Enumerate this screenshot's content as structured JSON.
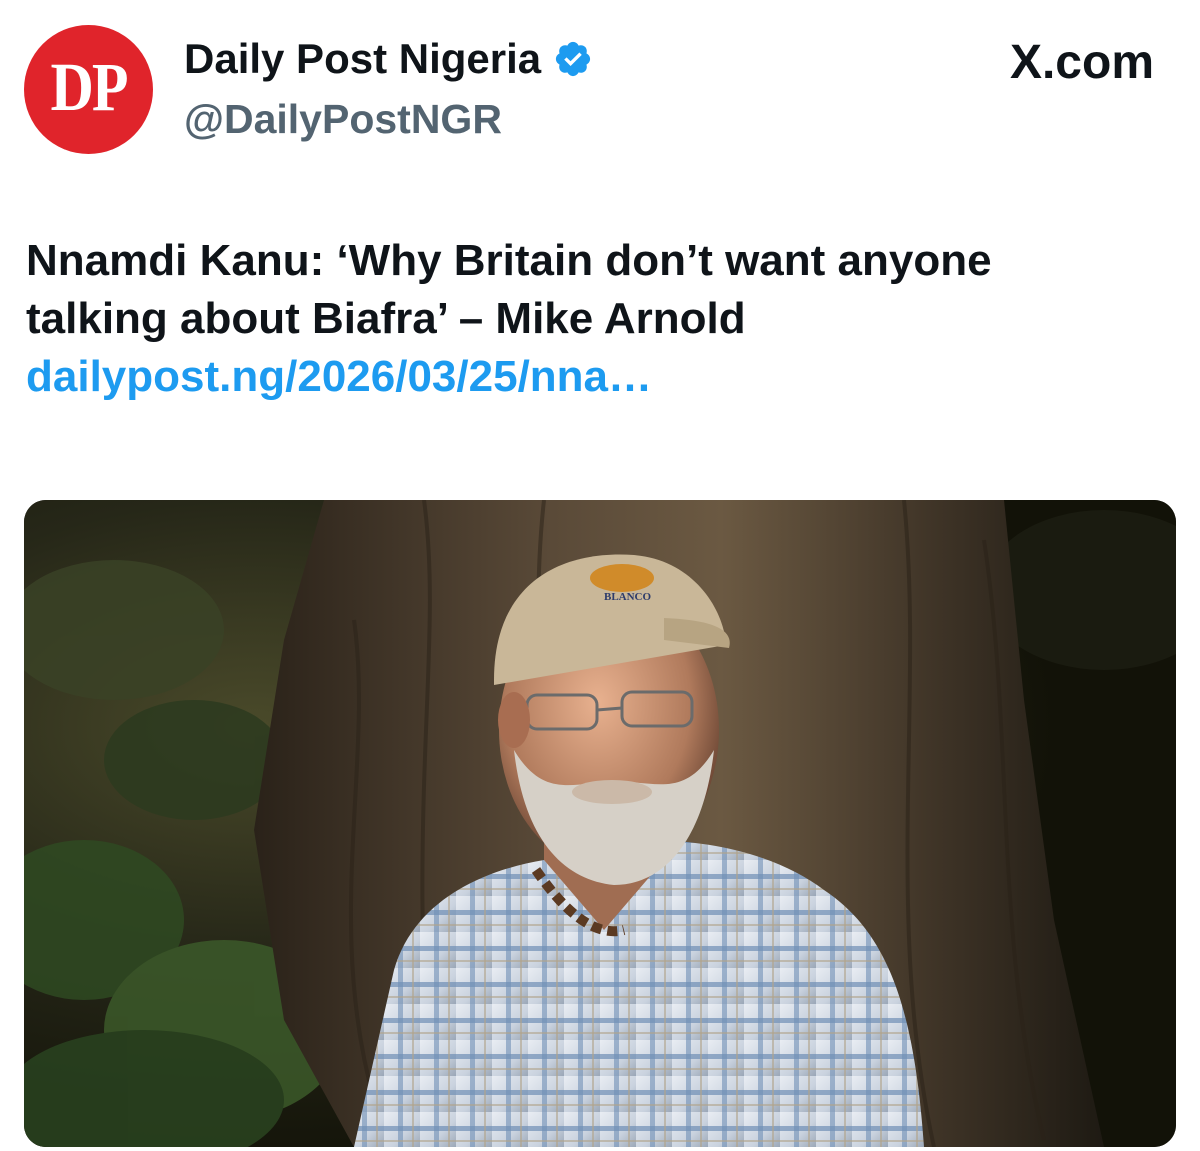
{
  "header": {
    "avatar_text": "DP",
    "display_name": "Daily Post Nigeria",
    "handle": "@DailyPostNGR",
    "verified": true,
    "brand": "X.com"
  },
  "tweet": {
    "line1": "Nnamdi Kanu: ‘Why Britain don’t want anyone",
    "line2": "talking about Biafra’ – Mike Arnold",
    "link": "dailypost.ng/2026/03/25/nna…"
  },
  "media": {
    "cap_text": "BLANCO"
  },
  "colors": {
    "avatar_bg": "#e0242b",
    "link": "#1d9bf0",
    "verified": "#1d9bf0",
    "handle": "#536471",
    "text": "#0f1419"
  },
  "icons": {
    "verified": "verified-badge-icon",
    "brand": "x-logo-icon"
  }
}
